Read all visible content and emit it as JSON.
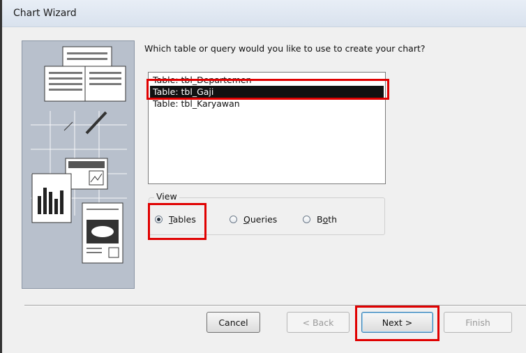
{
  "window": {
    "title": "Chart Wizard"
  },
  "prompt": "Which table or query would you like to use to create your chart?",
  "list": {
    "items": [
      {
        "label": "Table: tbl_Departemen",
        "selected": false
      },
      {
        "label": "Table: tbl_Gaji",
        "selected": true
      },
      {
        "label": "Table: tbl_Karyawan",
        "selected": false
      }
    ]
  },
  "view": {
    "legend": "View",
    "options": [
      {
        "label": "Tables",
        "mnemonic": "T",
        "rest": "ables",
        "checked": true
      },
      {
        "label": "Queries",
        "mnemonic": "Q",
        "rest": "ueries",
        "checked": false
      },
      {
        "label": "Both",
        "mnemonic": "o",
        "prefix": "B",
        "rest": "th",
        "checked": false
      }
    ]
  },
  "buttons": {
    "cancel": "Cancel",
    "back": "< Back",
    "next": "Next >",
    "finish": "Finish"
  },
  "colors": {
    "highlight": "#e00000",
    "selection": "#111111"
  }
}
